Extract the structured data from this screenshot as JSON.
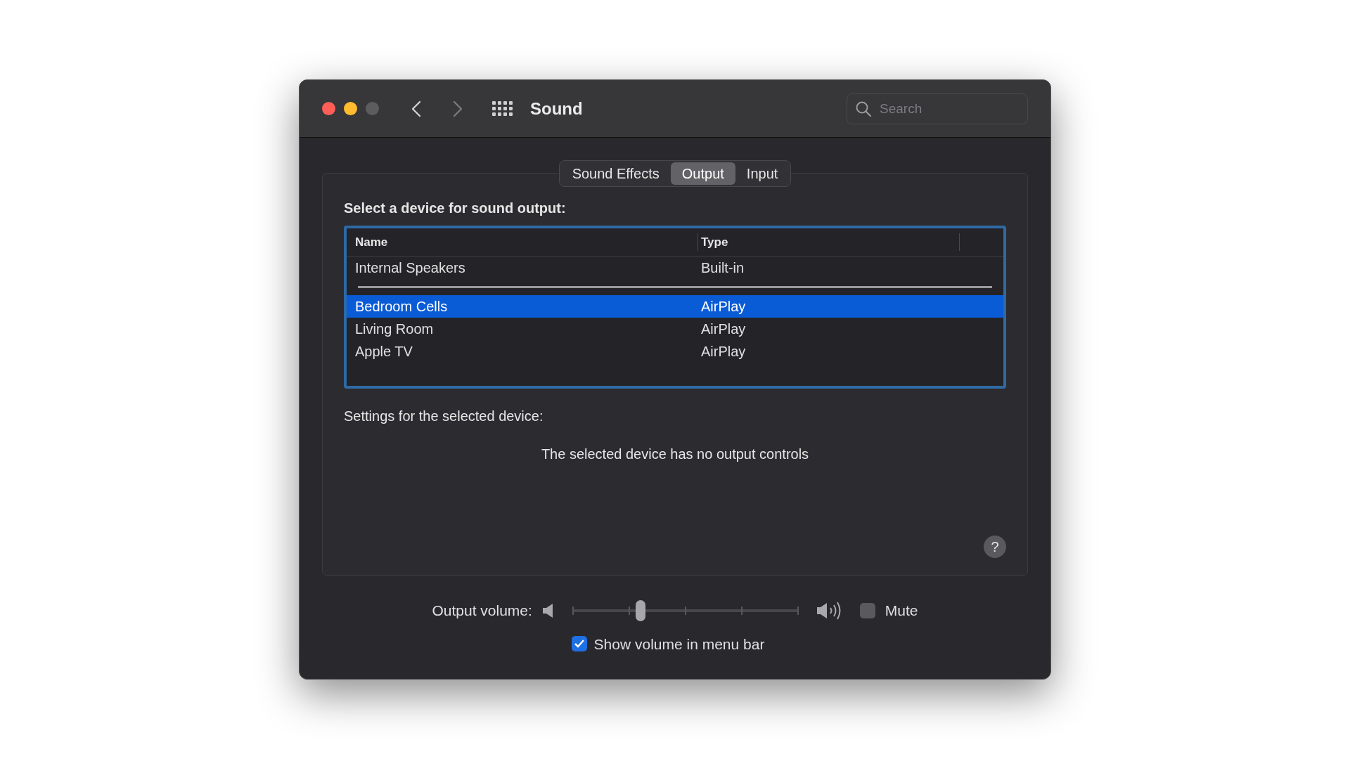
{
  "window": {
    "title": "Sound"
  },
  "search": {
    "placeholder": "Search"
  },
  "tabs": [
    {
      "label": "Sound Effects",
      "selected": false
    },
    {
      "label": "Output",
      "selected": true
    },
    {
      "label": "Input",
      "selected": false
    }
  ],
  "device_list": {
    "heading": "Select a device for sound output:",
    "columns": [
      "Name",
      "Type"
    ],
    "groups": [
      [
        {
          "name": "Internal  Speakers",
          "type": "Built-in",
          "selected": false
        }
      ],
      [
        {
          "name": "Bedroom Cells",
          "type": "AirPlay",
          "selected": true
        },
        {
          "name": "Living Room",
          "type": "AirPlay",
          "selected": false
        },
        {
          "name": "Apple TV",
          "type": "AirPlay",
          "selected": false
        }
      ]
    ]
  },
  "settings": {
    "label": "Settings for the selected device:",
    "message": "The selected device has no output controls"
  },
  "help_button": "?",
  "output_volume": {
    "label": "Output volume:",
    "level": 0.3,
    "mute_label": "Mute",
    "muted": false
  },
  "show_in_menu_bar": {
    "label": "Show volume in menu bar",
    "checked": true
  }
}
